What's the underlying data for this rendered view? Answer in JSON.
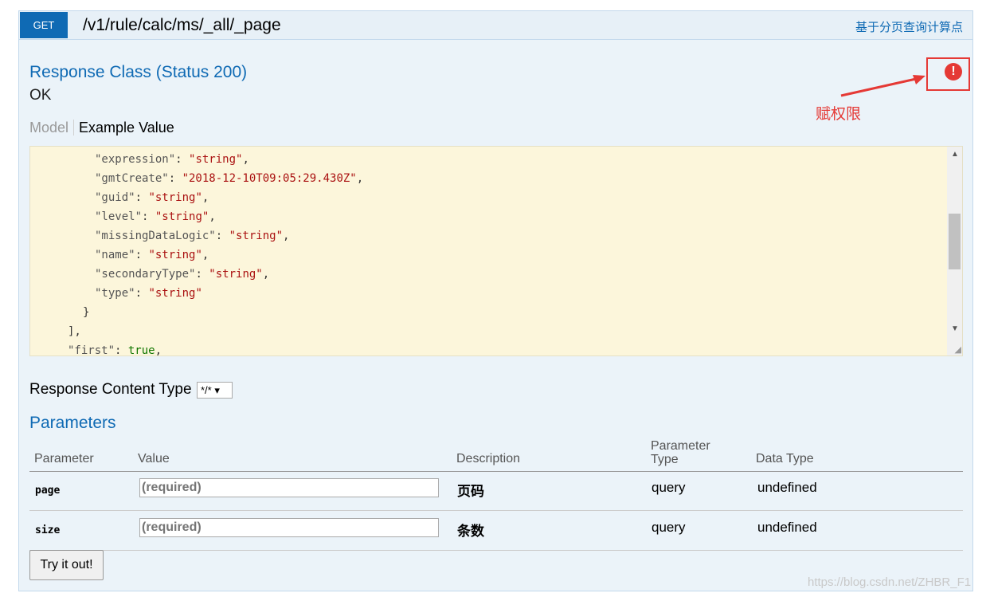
{
  "operation": {
    "method": "GET",
    "path": "/v1/rule/calc/ms/_all/_page",
    "summary": "基于分页查询计算点"
  },
  "response": {
    "class_title": "Response Class (Status 200)",
    "status_text": "OK"
  },
  "annotation": {
    "label": "赋权限",
    "icon": "exclamation-circle-icon",
    "icon_glyph": "!",
    "color": "#e53935"
  },
  "model_tabs": {
    "model": "Model",
    "example": "Example Value"
  },
  "example_json": {
    "lines": [
      {
        "key": "\"expression\"",
        "value": "\"string\"",
        "suffix": ","
      },
      {
        "key": "\"gmtCreate\"",
        "value": "\"2018-12-10T09:05:29.430Z\"",
        "suffix": ","
      },
      {
        "key": "\"guid\"",
        "value": "\"string\"",
        "suffix": ","
      },
      {
        "key": "\"level\"",
        "value": "\"string\"",
        "suffix": ","
      },
      {
        "key": "\"missingDataLogic\"",
        "value": "\"string\"",
        "suffix": ","
      },
      {
        "key": "\"name\"",
        "value": "\"string\"",
        "suffix": ","
      },
      {
        "key": "\"secondaryType\"",
        "value": "\"string\"",
        "suffix": ","
      },
      {
        "key": "\"type\"",
        "value": "\"string\"",
        "suffix": ""
      },
      {
        "punct": "}"
      },
      {
        "punct": "],"
      },
      {
        "key": "\"first\"",
        "value": "true",
        "suffix": ","
      }
    ]
  },
  "response_content_type": {
    "label": "Response Content Type",
    "selected": "*/*"
  },
  "parameters": {
    "title": "Parameters",
    "headers": {
      "parameter": "Parameter",
      "value": "Value",
      "description": "Description",
      "parameter_type_line1": "Parameter",
      "parameter_type_line2": "Type",
      "data_type": "Data Type"
    },
    "rows": [
      {
        "name": "page",
        "placeholder": "(required)",
        "description": "页码",
        "param_type": "query",
        "data_type": "undefined"
      },
      {
        "name": "size",
        "placeholder": "(required)",
        "description": "条数",
        "param_type": "query",
        "data_type": "undefined"
      }
    ]
  },
  "try_button": "Try it out!",
  "watermark": "https://blog.csdn.net/ZHBR_F1",
  "colors": {
    "accent": "#0f6ab4",
    "panel_bg": "#ebf3f9",
    "code_bg": "#fcf6db"
  }
}
